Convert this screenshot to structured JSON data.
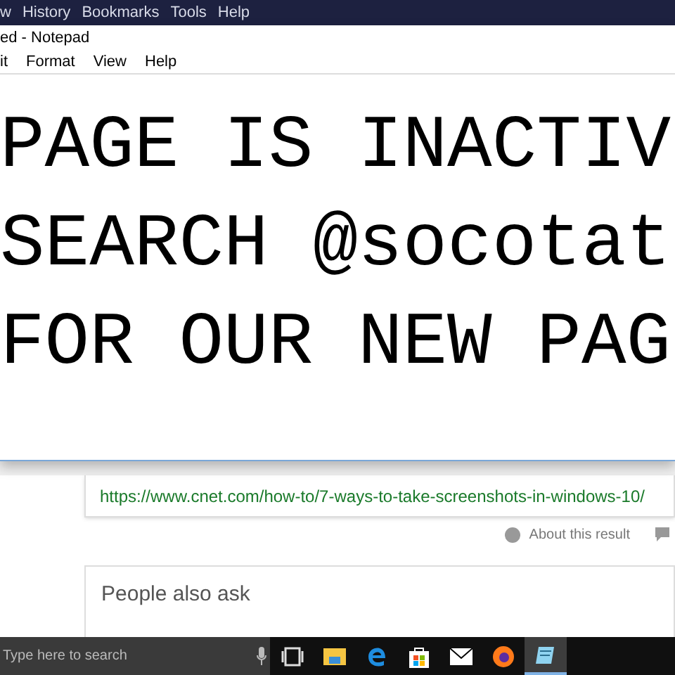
{
  "browser_menu": [
    "w",
    "History",
    "Bookmarks",
    "Tools",
    "Help"
  ],
  "notepad": {
    "title": "ed - Notepad",
    "menu": [
      "it",
      "Format",
      "View",
      "Help"
    ],
    "lines": [
      "PAGE IS INACTIV",
      "SEARCH @socotat",
      "FOR OUR NEW PAG"
    ]
  },
  "result": {
    "url": "https://www.cnet.com/how-to/7-ways-to-take-screenshots-in-windows-10/",
    "about": "About this result"
  },
  "people_also_ask": {
    "heading": "People also ask"
  },
  "taskbar": {
    "search_placeholder": "Type here to search",
    "apps": [
      {
        "kind": "taskview",
        "selected": false
      },
      {
        "kind": "explorer",
        "selected": false
      },
      {
        "kind": "edge",
        "selected": false
      },
      {
        "kind": "store",
        "selected": false
      },
      {
        "kind": "mail",
        "selected": false
      },
      {
        "kind": "firefox",
        "selected": false
      },
      {
        "kind": "notepad",
        "selected": true
      }
    ]
  }
}
